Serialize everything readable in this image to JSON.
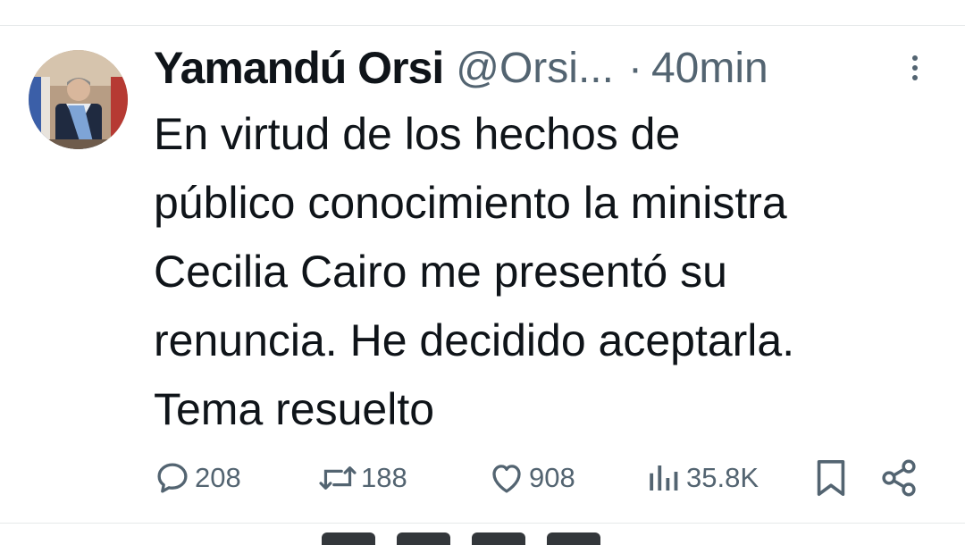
{
  "tweet": {
    "display_name": "Yamandú Orsi",
    "handle": "@Orsi...",
    "separator": "·",
    "time": "40min",
    "text_lines": [
      "En virtud de los hechos de",
      "público conocimiento la ministra",
      "Cecilia Cairo me presentó su",
      "renuncia. He decidido aceptarla.",
      "Tema resuelto"
    ]
  },
  "actions": {
    "replies": "208",
    "reposts": "188",
    "likes": "908",
    "views": "35.8K"
  },
  "icons": {
    "avatar": "profile-photo",
    "more": "more-vertical-icon",
    "reply": "reply-icon",
    "repost": "repost-icon",
    "like": "heart-icon",
    "views": "views-chart-icon",
    "bookmark": "bookmark-icon",
    "share": "share-icon"
  },
  "colors": {
    "text": "#0f1419",
    "secondary": "#536471",
    "divider": "#e6e9ea"
  }
}
